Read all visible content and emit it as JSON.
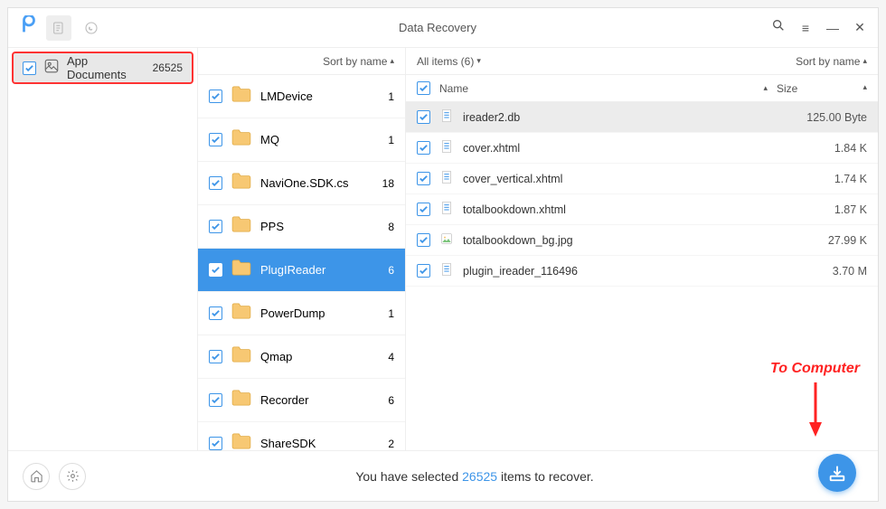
{
  "titlebar": {
    "title": "Data Recovery"
  },
  "sidebar": {
    "items": [
      {
        "label": "App Documents",
        "count": "26525"
      }
    ]
  },
  "middle": {
    "sort_label": "Sort by name",
    "folders": [
      {
        "name": "LMDevice",
        "count": "1",
        "selected": false
      },
      {
        "name": "MQ",
        "count": "1",
        "selected": false
      },
      {
        "name": "NaviOne.SDK.cs",
        "count": "18",
        "selected": false
      },
      {
        "name": "PPS",
        "count": "8",
        "selected": false
      },
      {
        "name": "PlugIReader",
        "count": "6",
        "selected": true
      },
      {
        "name": "PowerDump",
        "count": "1",
        "selected": false
      },
      {
        "name": "Qmap",
        "count": "4",
        "selected": false
      },
      {
        "name": "Recorder",
        "count": "6",
        "selected": false
      },
      {
        "name": "ShareSDK",
        "count": "2",
        "selected": false
      }
    ]
  },
  "right": {
    "header_label": "All items (6)",
    "sort_label": "Sort by name",
    "col_name": "Name",
    "col_size": "Size",
    "files": [
      {
        "name": "ireader2.db",
        "size": "125.00 Byte",
        "type": "doc",
        "selected": true
      },
      {
        "name": "cover.xhtml",
        "size": "1.84 K",
        "type": "doc",
        "selected": false
      },
      {
        "name": "cover_vertical.xhtml",
        "size": "1.74 K",
        "type": "doc",
        "selected": false
      },
      {
        "name": "totalbookdown.xhtml",
        "size": "1.87 K",
        "type": "doc",
        "selected": false
      },
      {
        "name": "totalbookdown_bg.jpg",
        "size": "27.99 K",
        "type": "img",
        "selected": false
      },
      {
        "name": "plugin_ireader_116496",
        "size": "3.70 M",
        "type": "doc",
        "selected": false
      }
    ]
  },
  "footer": {
    "text_pre": "You have selected ",
    "count": "26525",
    "text_post": " items to recover."
  },
  "annotation": {
    "text": "To Computer"
  }
}
